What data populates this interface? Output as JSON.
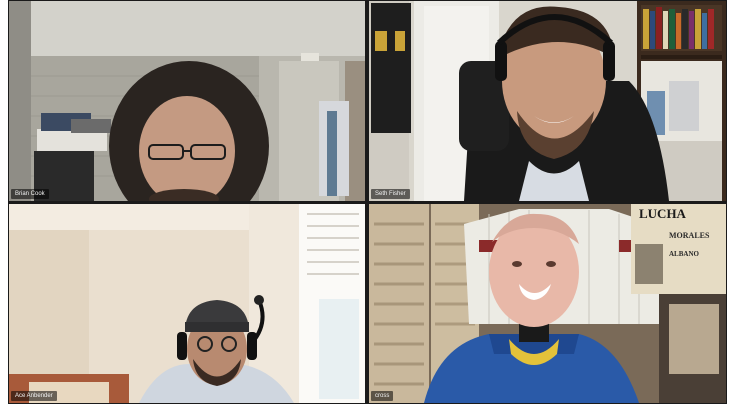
{
  "meeting": {
    "participants": [
      {
        "name": "Brian Cook",
        "active_speaker": true,
        "background": "basement"
      },
      {
        "name": "Seth Fisher",
        "active_speaker": false,
        "background": "bookshelf"
      },
      {
        "name": "Ace Anbender",
        "active_speaker": false,
        "background": "bedroom"
      },
      {
        "name": "cross",
        "active_speaker": false,
        "background": "jersey-wall"
      }
    ],
    "poster": {
      "line1": "LUCHA",
      "line2": "MORALES",
      "line3": "ALBANO"
    }
  },
  "colors": {
    "active_speaker_border": "#c8d84a",
    "grid_background": "#1a1a1a",
    "label_background": "rgba(0,0,0,0.55)",
    "label_text": "#f2f2f2"
  }
}
